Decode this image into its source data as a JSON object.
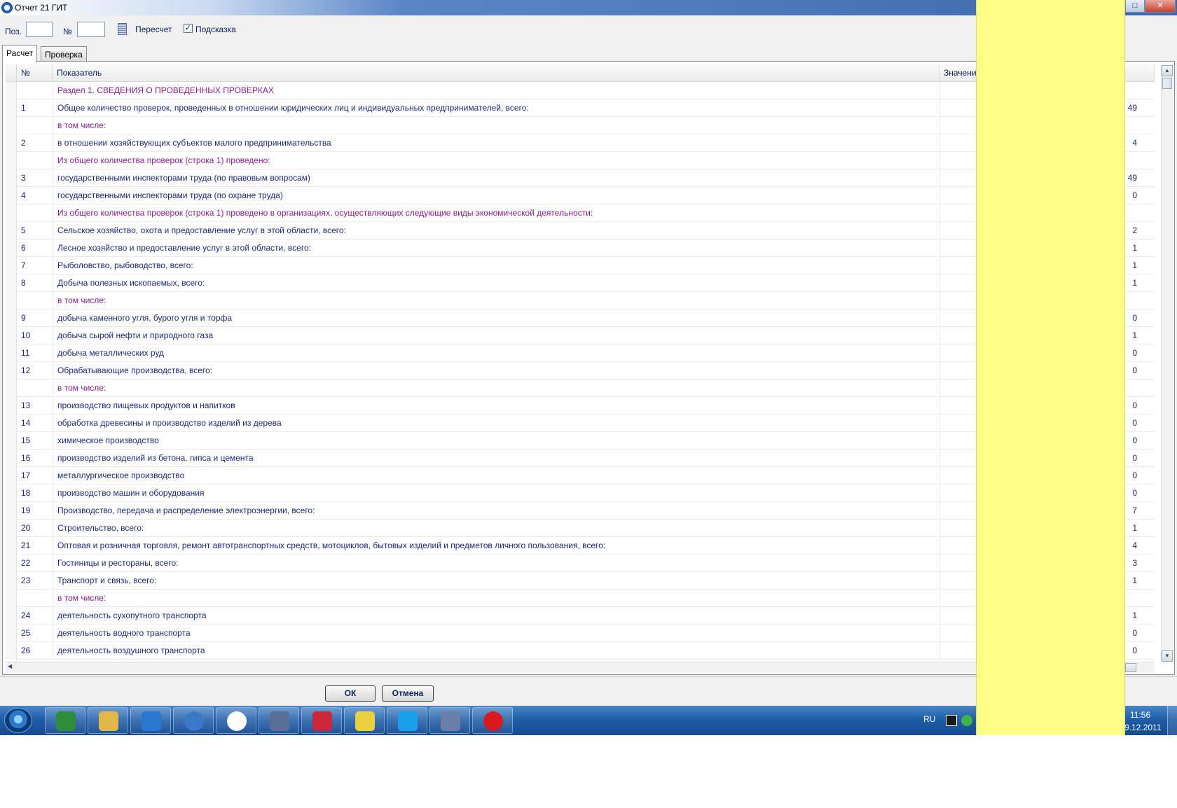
{
  "window": {
    "title": "Отчет 21 ГИТ"
  },
  "toolbar": {
    "pos_label": "Поз.",
    "pos_value": "",
    "num_label": "№",
    "num_value": "",
    "recalc_label": "Пересчет",
    "hint_label": "Подсказка",
    "hint_checked": true
  },
  "tabs": [
    {
      "label": "Расчет",
      "active": true
    },
    {
      "label": "Проверка",
      "active": false
    }
  ],
  "grid": {
    "headers": {
      "num": "№",
      "name": "Показатель",
      "value": "Значение"
    },
    "rows": [
      {
        "num": "",
        "name": "Раздел 1. СВЕДЕНИЯ О ПРОВЕДЕННЫХ ПРОВЕРКАХ",
        "value": "",
        "section": true
      },
      {
        "num": "1",
        "name": "Общее количество проверок, проведенных в отношении юридических лиц и индивидуальных предпринимателей, всего:",
        "value": "49",
        "section": false
      },
      {
        "num": "",
        "name": "в том числе:",
        "value": "",
        "section": true
      },
      {
        "num": "2",
        "name": "в отношении хозяйствующих субъектов малого предпринимательства",
        "value": "4",
        "section": false
      },
      {
        "num": "",
        "name": "Из общего количества проверок (строка 1) проведено:",
        "value": "",
        "section": true
      },
      {
        "num": "3",
        "name": "государственными инспекторами труда (по правовым вопросам)",
        "value": "49",
        "section": false
      },
      {
        "num": "4",
        "name": "государственными инспекторами труда (по охране труда)",
        "value": "0",
        "section": false
      },
      {
        "num": "",
        "name": "Из общего количества проверок (строка 1) проведено в организациях, осуществляющих следующие виды экономической деятельности:",
        "value": "",
        "section": true
      },
      {
        "num": "5",
        "name": "Сельское хозяйство, охота и предоставление услуг в этой области, всего:",
        "value": "2",
        "section": false
      },
      {
        "num": "6",
        "name": "Лесное хозяйство и предоставление услуг в этой области, всего:",
        "value": "1",
        "section": false
      },
      {
        "num": "7",
        "name": "Рыболовство, рыбоводство, всего:",
        "value": "1",
        "section": false
      },
      {
        "num": "8",
        "name": "Добыча полезных ископаемых, всего:",
        "value": "1",
        "section": false
      },
      {
        "num": "",
        "name": "в том числе:",
        "value": "",
        "section": true
      },
      {
        "num": "9",
        "name": "добыча каменного угля, бурого угля и торфа",
        "value": "0",
        "section": false
      },
      {
        "num": "10",
        "name": "добыча сырой нефти и природного газа",
        "value": "1",
        "section": false
      },
      {
        "num": "11",
        "name": "добыча металлических руд",
        "value": "0",
        "section": false
      },
      {
        "num": "12",
        "name": "Обрабатывающие производства, всего:",
        "value": "0",
        "section": false
      },
      {
        "num": "",
        "name": "в том числе:",
        "value": "",
        "section": true
      },
      {
        "num": "13",
        "name": "производство пищевых продуктов и напитков",
        "value": "0",
        "section": false
      },
      {
        "num": "14",
        "name": "обработка древесины и производство изделий из дерева",
        "value": "0",
        "section": false
      },
      {
        "num": "15",
        "name": "химическое производство",
        "value": "0",
        "section": false
      },
      {
        "num": "16",
        "name": "производство изделий из бетона, гипса и цемента",
        "value": "0",
        "section": false
      },
      {
        "num": "17",
        "name": "металлургическое производство",
        "value": "0",
        "section": false
      },
      {
        "num": "18",
        "name": "производство машин и оборудования",
        "value": "0",
        "section": false
      },
      {
        "num": "19",
        "name": "Производство, передача и распределение электроэнергии, всего:",
        "value": "7",
        "section": false
      },
      {
        "num": "20",
        "name": "Строительство, всего:",
        "value": "1",
        "section": false
      },
      {
        "num": "21",
        "name": "Оптовая и розничная торговля, ремонт автотранспортных средств, мотоциклов, бытовых изделий и предметов личного пользования, всего:",
        "value": "4",
        "section": false
      },
      {
        "num": "22",
        "name": "Гостиницы и рестораны, всего:",
        "value": "3",
        "section": false
      },
      {
        "num": "23",
        "name": "Транспорт и связь, всего:",
        "value": "1",
        "section": false
      },
      {
        "num": "",
        "name": "в том числе:",
        "value": "",
        "section": true
      },
      {
        "num": "24",
        "name": "деятельность сухопутного транспорта",
        "value": "1",
        "section": false
      },
      {
        "num": "25",
        "name": "деятельность водного транспорта",
        "value": "0",
        "section": false
      },
      {
        "num": "26",
        "name": "деятельность воздушного транспорта",
        "value": "0",
        "section": false
      }
    ]
  },
  "footer": {
    "ok_label": "ОК",
    "cancel_label": "Отмена"
  },
  "taskbar": {
    "apps": [
      "clover-icon",
      "explorer-icon",
      "internet-explorer-icon",
      "browser-icon",
      "report-app-icon",
      "mail-icon",
      "save-disk-icon",
      "sticky-notes-icon",
      "skype-icon",
      "search-tool-icon",
      "opera-icon"
    ],
    "language": "RU",
    "time": "11:56",
    "date": "9.12.2011"
  },
  "colors": {
    "text_main": "#1c2a7a",
    "text_section": "#8b1e93",
    "overlay": "#ffff88",
    "taskbar": "#1f5ea8"
  }
}
